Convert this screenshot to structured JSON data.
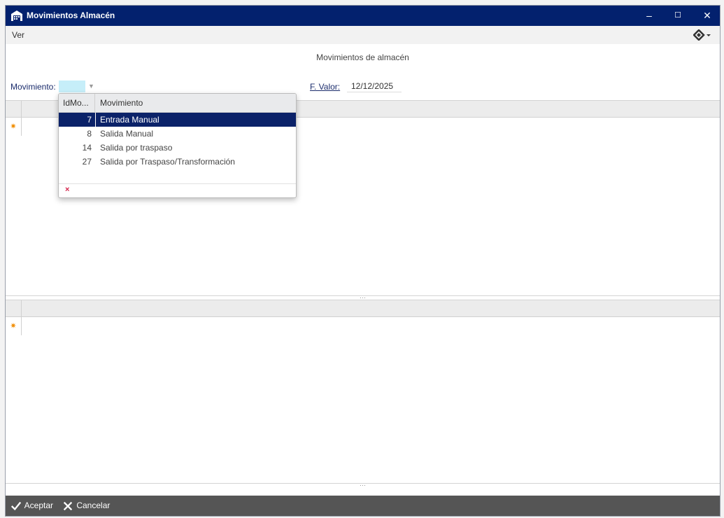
{
  "window": {
    "title": "Movimientos Almacén",
    "icon": "warehouse-icon"
  },
  "window_controls": {
    "minimize": "–",
    "maximize": "☐",
    "close": "✕"
  },
  "menu": {
    "ver": "Ver",
    "brand_icon": "brand-logo-icon"
  },
  "header": {
    "title": "Movimientos de almacén"
  },
  "form": {
    "movimiento_label": "Movimiento:",
    "movimiento_value": "",
    "fvalor_label": "F. Valor:",
    "fvalor_value": "12/12/2025"
  },
  "dropdown": {
    "columns": [
      "IdMo...",
      "Movimiento"
    ],
    "rows": [
      {
        "id": "7",
        "name": "Entrada Manual"
      },
      {
        "id": "8",
        "name": "Salida Manual"
      },
      {
        "id": "14",
        "name": "Salida por traspaso"
      },
      {
        "id": "27",
        "name": "Salida por Traspaso/Transformación"
      }
    ],
    "selected_index": 0,
    "clear_icon": "×"
  },
  "grid_new_row_marker": "✷",
  "splitter_grip": "···",
  "footer": {
    "accept": "Aceptar",
    "cancel": "Cancelar"
  },
  "colors": {
    "titlebar": "#03216e",
    "selection": "#0b2269",
    "footer": "#555555",
    "combo": "#c6eef9",
    "new_row_marker": "#f08c00"
  }
}
